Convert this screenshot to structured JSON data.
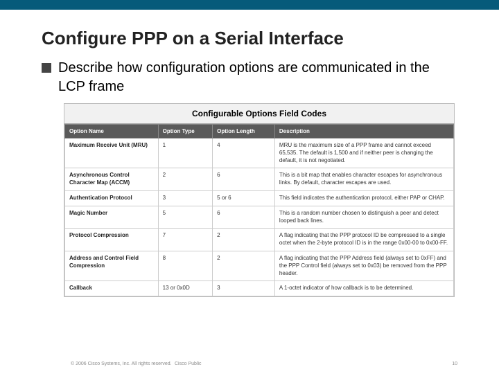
{
  "title": "Configure PPP on a Serial Interface",
  "bullet_text": "Describe how configuration options are communicated in the LCP frame",
  "table_title": "Configurable Options Field Codes",
  "headers": [
    "Option Name",
    "Option Type",
    "Option Length",
    "Description"
  ],
  "rows": [
    {
      "name": "Maximum Receive Unit (MRU)",
      "type": "1",
      "len": "4",
      "desc": "MRU is the maximum size of a PPP frame and cannot exceed 65,535. The default is 1,500 and if neither peer is changing the default, it is not negotiated."
    },
    {
      "name": "Asynchronous Control Character Map (ACCM)",
      "type": "2",
      "len": "6",
      "desc": "This is a bit map that enables character escapes for asynchronous links. By default, character escapes are used."
    },
    {
      "name": "Authentication Protocol",
      "type": "3",
      "len": "5 or 6",
      "desc": "This field indicates the authentication protocol, either PAP or CHAP."
    },
    {
      "name": "Magic Number",
      "type": "5",
      "len": "6",
      "desc": "This is a random number chosen to distinguish a peer and detect looped back lines."
    },
    {
      "name": "Protocol Compression",
      "type": "7",
      "len": "2",
      "desc": "A flag indicating that the PPP protocol ID be compressed to a single octet when the 2-byte protocol ID is in the range 0x00-00 to 0x00-FF."
    },
    {
      "name": "Address and Control Field Compression",
      "type": "8",
      "len": "2",
      "desc": "A flag indicating that the PPP Address field (always set to 0xFF) and the PPP Control field (always set to 0x03) be removed from the PPP header."
    },
    {
      "name": "Callback",
      "type": "13 or 0x0D",
      "len": "3",
      "desc": "A 1-octet indicator of how callback is to be determined."
    }
  ],
  "footer_copy": "© 2006 Cisco Systems, Inc. All rights reserved.",
  "footer_class": "Cisco Public",
  "footer_page": "10"
}
